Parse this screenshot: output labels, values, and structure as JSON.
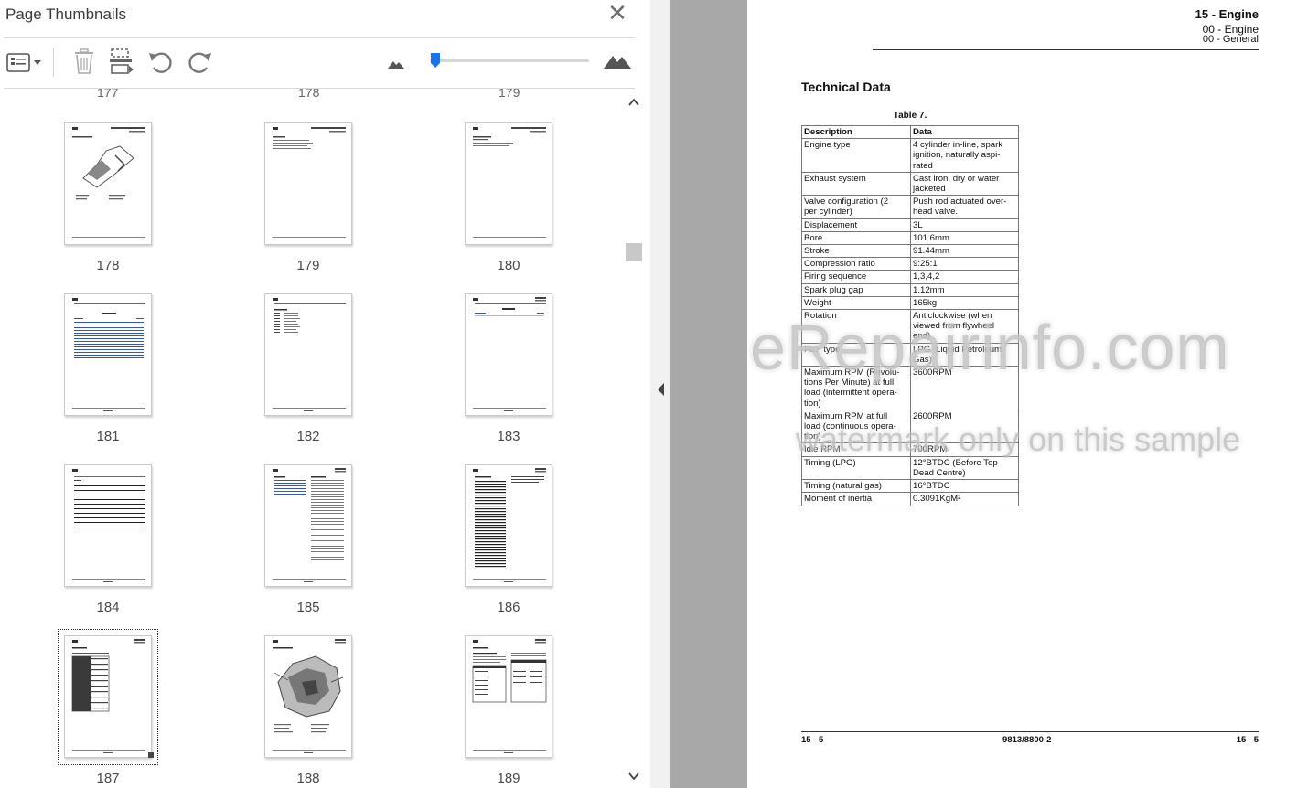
{
  "panel": {
    "title": "Page Thumbnails",
    "close_icon": "close-icon",
    "tools": [
      "options-list-icon",
      "delete-page-icon",
      "insert-page-icon",
      "rotate-counterclockwise-icon",
      "rotate-clockwise-icon",
      "zoom-out-mountain-icon",
      "zoom-in-mountain-icon"
    ],
    "zoom_level_fraction": 0.03
  },
  "thumbnails": {
    "partial_row": [
      "177",
      "178",
      "179"
    ],
    "rows": [
      [
        "178",
        "179",
        "180"
      ],
      [
        "181",
        "182",
        "183"
      ],
      [
        "184",
        "185",
        "186"
      ],
      [
        "187",
        "188",
        "189"
      ]
    ],
    "selected": "187"
  },
  "document": {
    "header": {
      "chapter": "15 - Engine",
      "sub1": "00 - Engine",
      "sub2": "00 - General"
    },
    "section_title": "Technical Data",
    "table_caption": "Table 7.",
    "table": {
      "headers": [
        "Description",
        "Data"
      ],
      "rows": [
        {
          "d": [
            "Engine type"
          ],
          "v": [
            "4 cylinder in-line, spark",
            "ignition, naturally aspi-",
            "rated"
          ]
        },
        {
          "d": [
            "Exhaust system"
          ],
          "v": [
            "Cast iron, dry or water",
            "jacketed"
          ]
        },
        {
          "d": [
            "Valve configuration (2",
            "per cylinder)"
          ],
          "v": [
            "Push rod actuated over-",
            "head valve."
          ]
        },
        {
          "d": [
            "Displacement"
          ],
          "v": [
            "3L"
          ]
        },
        {
          "d": [
            "Bore"
          ],
          "v": [
            "101.6mm"
          ]
        },
        {
          "d": [
            "Stroke"
          ],
          "v": [
            "91.44mm"
          ]
        },
        {
          "d": [
            "Compression ratio"
          ],
          "v": [
            "9:25:1"
          ]
        },
        {
          "d": [
            "Firing sequence"
          ],
          "v": [
            "1,3,4,2"
          ]
        },
        {
          "d": [
            "Spark plug gap"
          ],
          "v": [
            "1.12mm"
          ]
        },
        {
          "d": [
            "Weight"
          ],
          "v": [
            "165kg"
          ]
        },
        {
          "d": [
            "Rotation"
          ],
          "v": [
            "Anticlockwise (when",
            "viewed from flywheel",
            "end)"
          ]
        },
        {
          "d": [
            "Fuel type"
          ],
          "v": [
            "LPG (Liquid Petroleum",
            "Gas)"
          ]
        },
        {
          "d": [
            "Maximum RPM (Revolu-",
            "tions Per Minute) at full",
            "load (intermittent opera-",
            "tion)"
          ],
          "v": [
            "3600RPM"
          ]
        },
        {
          "d": [
            "Maximum RPM at full",
            "load (continuous opera-",
            "tion)"
          ],
          "v": [
            "2600RPM"
          ]
        },
        {
          "d": [
            "Idle RPM"
          ],
          "v": [
            "700RPM"
          ]
        },
        {
          "d": [
            "Timing (LPG)"
          ],
          "v": [
            "12°BTDC (Before Top",
            "Dead Centre)"
          ]
        },
        {
          "d": [
            "Timing (natural gas)"
          ],
          "v": [
            "16°BTDC"
          ]
        },
        {
          "d": [
            "Moment of inertia"
          ],
          "v": [
            "0.3091KgM²"
          ]
        }
      ]
    },
    "footer": {
      "left": "15 - 5",
      "center": "9813/8800-2",
      "right": "15 - 5"
    },
    "watermark": {
      "line1": "eRepairinfo.com",
      "line2": "watermark only on this sample"
    }
  }
}
